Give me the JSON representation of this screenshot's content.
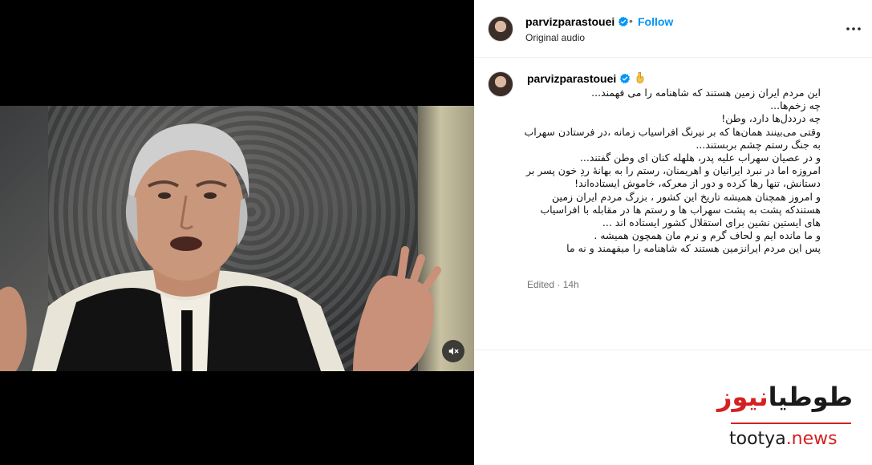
{
  "post": {
    "username": "parvizparastouei",
    "separator": "•",
    "follow_label": "Follow",
    "audio_label": "Original audio",
    "meta": "Edited · 14h"
  },
  "caption": {
    "username": "parvizparastouei",
    "lines": [
      "این مردم ایران زمین هستند که شاهنامه را می فهمند...",
      "چه زخم‌ها...",
      "چه درددل‌ها دارد، وطن!",
      "وقتی می‌بینند همان‌ها که بر نیرنگ افراسیاب زمانه ،در فرستادن سهراب",
      "به جنگ رستم چشم بربستند...",
      "و در عصیان سهراب علیه پدر، هلهله کنان ای وطن گفتند...",
      "امروزه اما در نبرد ایرانیان و اهریمنان، رستم را به بهانهٔ ردِ خون پسر بر",
      "دستانش، تنها رها کرده و دور از معرکه، خاموش ایستاده‌اند!",
      "و امروز همچنان همیشه تاریخ این کشور ، بزرگ مردم ایران زمین",
      "هستندکه پشت به پشت سهراب ها و رستم ها در مقابله با افراسیاب",
      "های ایستین نشین برای استقلال کشور ایستاده اند ...",
      "و ما مانده ایم و لحاف گرم و نرم مان همچون همیشه .",
      "پس این مردم ایرانزمین هستند که شاهنامه را میفهمند و نه ما"
    ]
  },
  "watermark": {
    "fa_black": "طوطیا",
    "fa_red": "نیوز",
    "en_black": "tootya",
    "en_red": ".news"
  },
  "icons": {
    "verified": "verified-badge-icon",
    "more": "more-options-icon",
    "mute": "muted-speaker-icon",
    "emoji": "pointing-down-hand-emoji"
  },
  "colors": {
    "follow": "#0095f6",
    "verified": "#0095f6",
    "watermark_red": "#d42121"
  }
}
